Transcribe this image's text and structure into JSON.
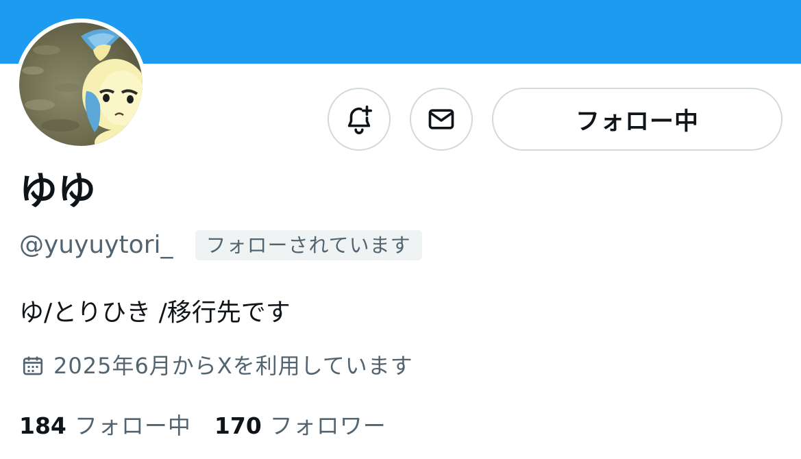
{
  "theme": {
    "banner_color": "#1d9bf0",
    "border_color": "#cfd9de",
    "text_primary": "#0f1419",
    "text_secondary": "#536471"
  },
  "profile": {
    "display_name": "ゆゆ",
    "handle": "@yuyuytori_",
    "follows_you_badge": "フォローされています",
    "bio": "ゆ/とりひき /移行先です",
    "joined": "2025年6月からXを利用しています",
    "avatar_icon": "profile-avatar-image"
  },
  "actions": {
    "notify_icon": "bell-plus-icon",
    "message_icon": "envelope-icon",
    "follow_label": "フォロー中"
  },
  "stats": {
    "following_count": "184",
    "following_label": "フォロー中",
    "followers_count": "170",
    "followers_label": "フォロワー"
  }
}
